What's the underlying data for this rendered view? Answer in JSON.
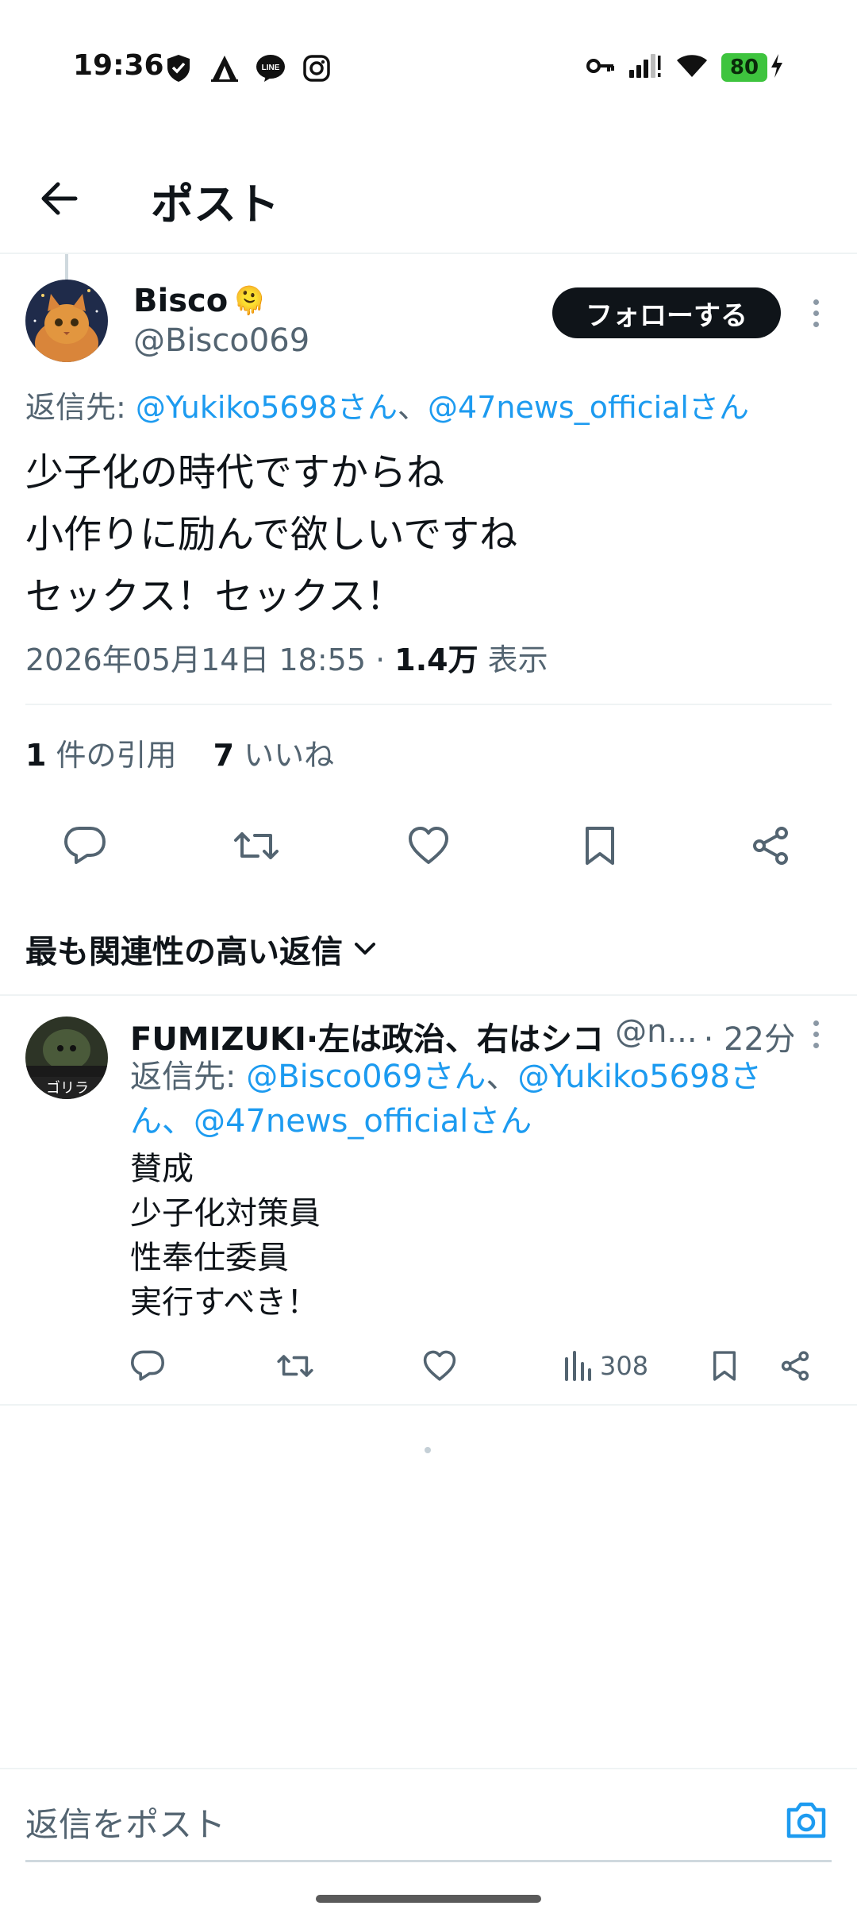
{
  "status_bar": {
    "time": "19:36",
    "battery": "80",
    "left_icons": [
      "shield-icon",
      "camp-icon",
      "line-app-icon",
      "instagram-icon"
    ],
    "right_icons": [
      "vpn-key-icon",
      "signal-icon",
      "wifi-icon",
      "battery-icon",
      "charging-icon"
    ]
  },
  "header": {
    "title": "ポスト"
  },
  "post": {
    "author_name": "Bisco",
    "author_emoji": "🫠",
    "author_handle": "@Bisco069",
    "follow_label": "フォローする",
    "reply_prefix": "返信先: ",
    "mentions": [
      "@Yukiko5698さん",
      "@47news_officialさん"
    ],
    "mention_separator": "、",
    "body_lines": [
      "少子化の時代ですからね",
      "小作りに励んで欲しいですね",
      "セックス！セックス！"
    ],
    "timestamp": "2026年05月14日 18:55",
    "meta_dot": " · ",
    "views_count": "1.4万",
    "views_label": " 表示",
    "quotes_count": "1",
    "quotes_label": " 件の引用",
    "likes_count": "7",
    "likes_label": " いいね"
  },
  "replies_sort": {
    "label": "最も関連性の高い返信"
  },
  "reply": {
    "author_name": "FUMIZUKI·左は政治、右はシコ",
    "handle_truncated": "@n...",
    "time": "· 22分",
    "avatar_caption": "ゴリラ",
    "reply_prefix": "返信先: ",
    "mentions": [
      "@Bisco069さん",
      "@Yukiko5698さ",
      "ん、@47news_officialさん"
    ],
    "mention_separator": "、",
    "body_lines": [
      "賛成",
      "少子化対策員",
      "性奉仕委員",
      "実行すべき！"
    ],
    "views_count": "308"
  },
  "composer": {
    "placeholder": "返信をポスト"
  },
  "colors": {
    "accent": "#1d9bf0",
    "text": "#0f1419",
    "secondary": "#536471",
    "battery": "#3ec43e"
  }
}
